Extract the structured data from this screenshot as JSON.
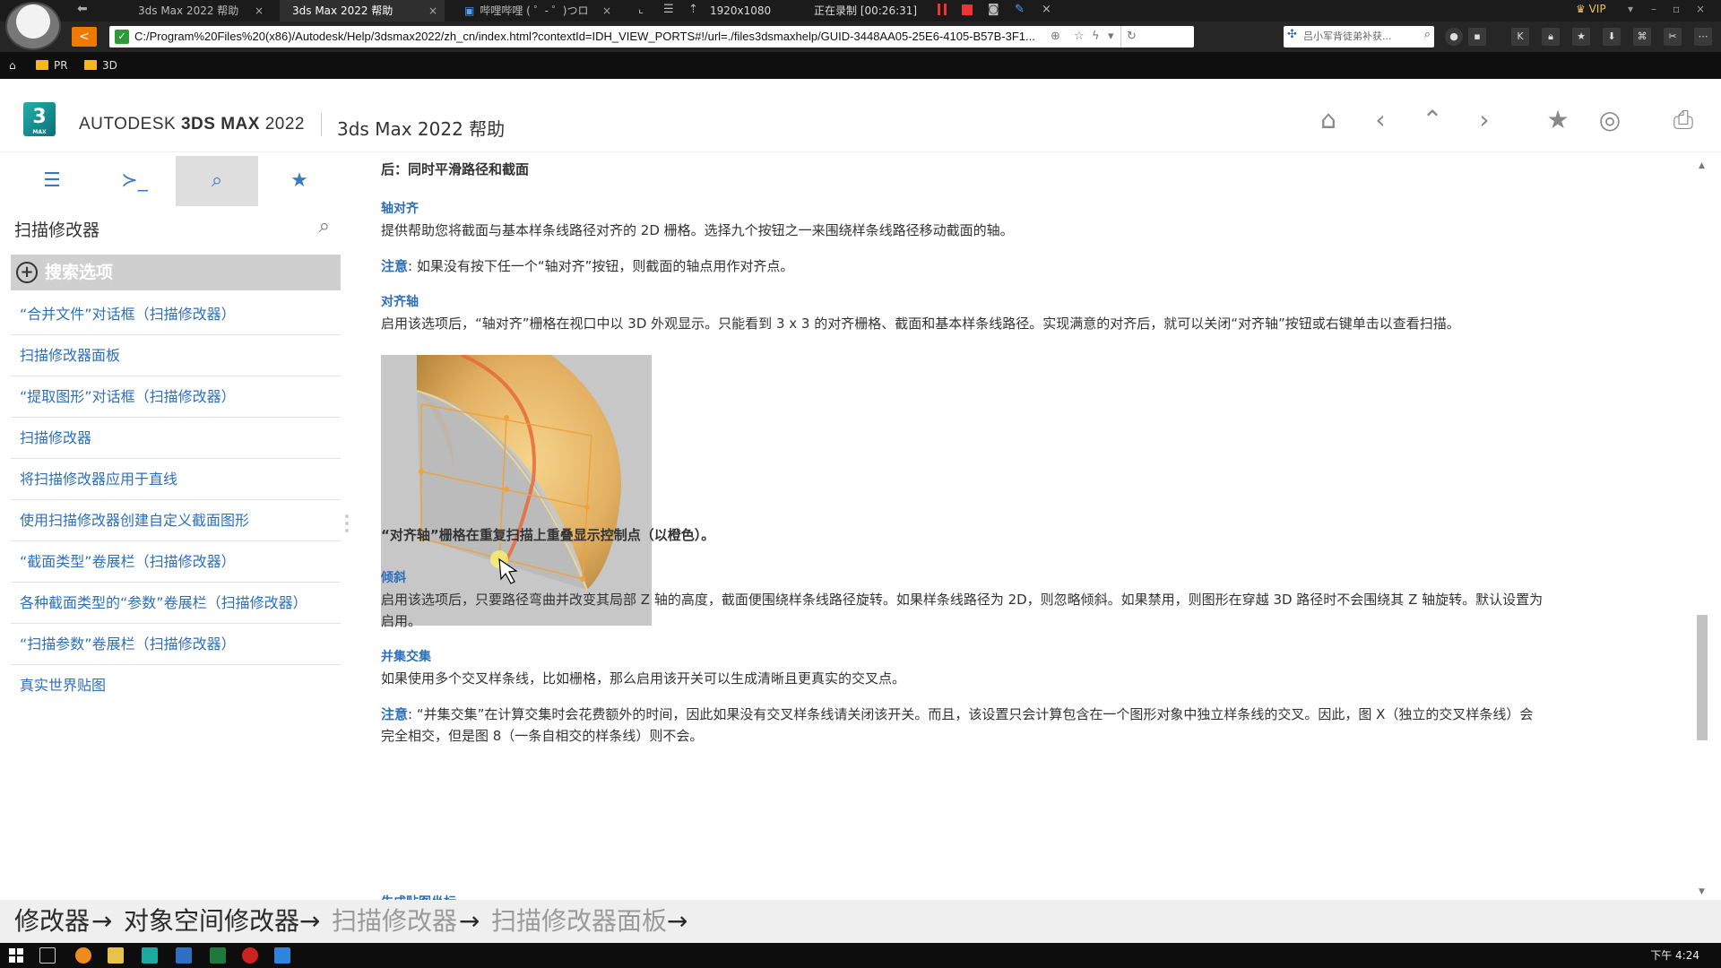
{
  "browser": {
    "tabs": [
      {
        "label": "3ds Max 2022 帮助",
        "active": false
      },
      {
        "label": "3ds Max 2022 帮助",
        "active": true
      },
      {
        "label": "哔哩哔哩 ( ゜- ゜)つロ",
        "active": false
      }
    ],
    "resolution": "1920x1080",
    "recording": "正在录制 [00:26:31]",
    "vip": "VIP",
    "url": "C:/Program%20Files%20(x86)/Autodesk/Help/3dsmax2022/zh_cn/index.html?contextId=IDH_VIEW_PORTS#!/url=./files3dsmaxhelp/GUID-3448AA05-25E6-4105-B57B-3F1...",
    "search_placeholder": "吕小军背徒弟补获...",
    "bookmarks": [
      {
        "label": "PR",
        "icon": "folder-icon"
      },
      {
        "label": "3D",
        "icon": "folder-icon"
      }
    ]
  },
  "header": {
    "logo_char": "3",
    "logo_sub": "MAX",
    "brand_prefix": "AUTODESK",
    "brand_product": "3DS MAX",
    "brand_year": "2022",
    "title": "3ds Max 2022 帮助",
    "buttons": [
      "home-icon",
      "previous-icon",
      "up-icon",
      "next-icon",
      "favorite-icon",
      "share-icon",
      "print-icon"
    ]
  },
  "sidebar": {
    "tabs": [
      {
        "name": "contents-tab",
        "icon": "list-icon"
      },
      {
        "name": "command-tab",
        "icon": "terminal-icon"
      },
      {
        "name": "search-tab",
        "icon": "search-icon",
        "active": true
      },
      {
        "name": "favorites-tab",
        "icon": "star-icon"
      }
    ],
    "search_value": "扫描修改器",
    "search_options_label": "搜索选项",
    "results": [
      "“合并文件”对话框（扫描修改器）",
      "扫描修改器面板",
      "“提取图形”对话框（扫描修改器）",
      "扫描修改器",
      "将扫描修改器应用于直线",
      "使用扫描修改器创建自定义截面图形",
      "“截面类型”卷展栏（扫描修改器）",
      "各种截面类型的“参数”卷展栏（扫描修改器）",
      "“扫描参数”卷展栏（扫描修改器）",
      "真实世界贴图"
    ]
  },
  "content": {
    "heading_after": "后：同时平滑路径和截面",
    "axis_align_term": "轴对齐",
    "axis_align_desc": "提供帮助您将截面与基本样条线路径对齐的 2D 栅格。选择九个按钮之一来围绕样条线路径移动截面的轴。",
    "note_label": "注意",
    "axis_align_note": ": 如果没有按下任一个“轴对齐”按钮，则截面的轴点用作对齐点。",
    "align_pivot_term": "对齐轴",
    "align_pivot_desc": "启用该选项后，“轴对齐”栅格在视口中以 3D 外观显示。只能看到 3 x 3 的对齐栅格、截面和基本样条线路径。实现满意的对齐后，就可以关闭“对齐轴”按钮或右键单击以查看扫描。",
    "figure_caption": "“对齐轴”栅格在重复扫描上重叠显示控制点（以橙色）。",
    "banking_term": "倾斜",
    "banking_desc_1": "启用该选项后，只要路径弯曲并改变其局部 Z 轴的高度，截面便围绕样条线路径旋转。如果样条线路径为 2D，则忽略倾斜。如果禁用，则图形在穿越 3D 路径时不会围绕其 Z 轴旋转。默认设置为",
    "banking_desc_2": "启用。",
    "union_term": "并集交集",
    "union_desc": "如果使用多个交叉样条线，比如栅格，那么启用该开关可以生成清晰且更真实的交叉点。",
    "union_note_1": ": “并集交集”在计算交集时会花费额外的时间，因此如果没有交叉样条线请关闭该开关。而且，该设置只会计算包含在一个图形对象中独立样条线的交叉。因此，图 X（独立的交叉样条线）会",
    "union_note_2": "完全相交，但是图 8（一条自相交的样条线）则不会。",
    "cutoff_term": "生成贴图坐标"
  },
  "overlay": {
    "crumbs": [
      {
        "text": "修改器",
        "style": "dark"
      },
      {
        "text": "→",
        "style": "dark"
      },
      {
        "text": "对象空间修改器",
        "style": "dark"
      },
      {
        "text": "→",
        "style": "dark"
      },
      {
        "text": "扫描修改器",
        "style": "light"
      },
      {
        "text": "→",
        "style": "dark"
      },
      {
        "text": "扫描修改器面板",
        "style": "light"
      },
      {
        "text": "→",
        "style": "dark"
      }
    ]
  },
  "taskbar": {
    "clock": "下午 4:24"
  },
  "colors": {
    "accent_link": "#2d6fb8",
    "nav_back": "#f07a00",
    "record_red": "#ee3333",
    "grid_orange": "#f0a23a"
  }
}
